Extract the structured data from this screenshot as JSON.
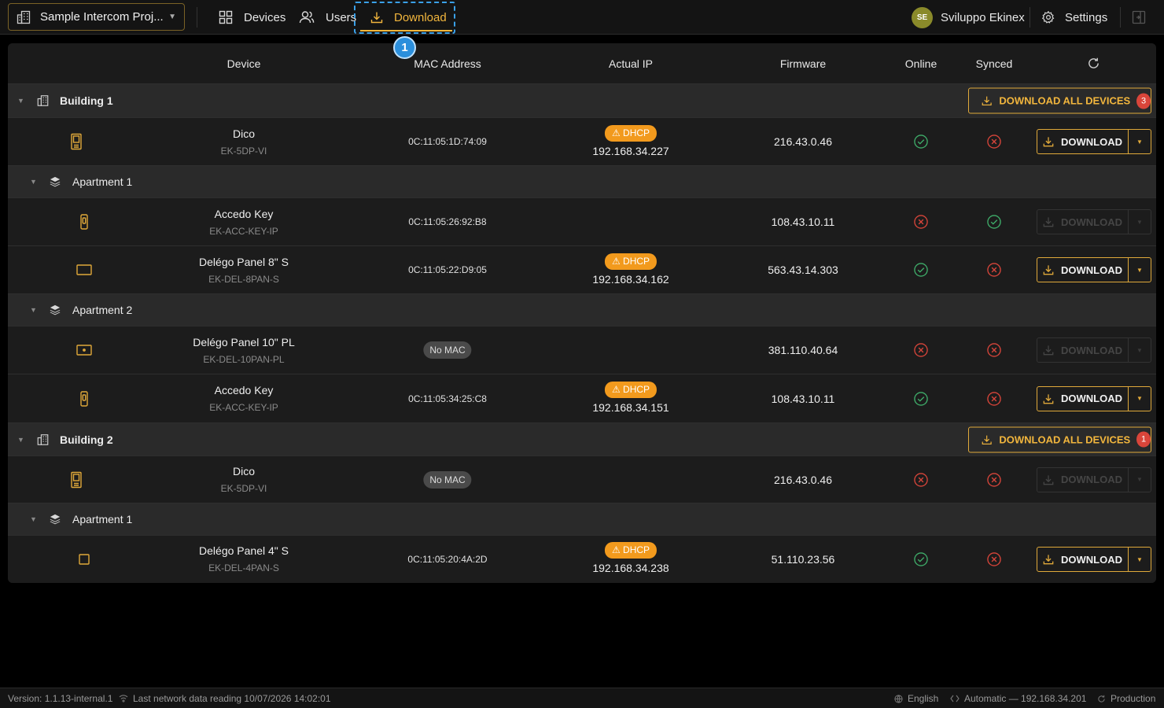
{
  "topbar": {
    "project_name": "Sample Intercom Proj...",
    "nav": {
      "devices": "Devices",
      "users": "Users",
      "download": "Download"
    },
    "step_badge": "1",
    "user": {
      "initials": "SE",
      "name": "Sviluppo Ekinex"
    },
    "settings": "Settings"
  },
  "table": {
    "headers": {
      "device": "Device",
      "mac": "MAC Address",
      "ip": "Actual IP",
      "firmware": "Firmware",
      "online": "Online",
      "synced": "Synced"
    },
    "download_label": "DOWNLOAD",
    "download_all_label": "DOWNLOAD ALL DEVICES",
    "dhcp_label": "⚠ DHCP",
    "no_mac_label": "No MAC",
    "building1": {
      "name": "Building 1",
      "pending": "3",
      "dico": {
        "name": "Dico",
        "model": "EK-5DP-VI",
        "mac": "0C:11:05:1D:74:09",
        "ip": "192.168.34.227",
        "firmware": "216.43.0.46",
        "online": true,
        "synced": false
      },
      "apt1": {
        "name": "Apartment 1",
        "key": {
          "name": "Accedo Key",
          "model": "EK-ACC-KEY-IP",
          "mac": "0C:11:05:26:92:B8",
          "firmware": "108.43.10.11",
          "online": false,
          "synced": true
        },
        "panel": {
          "name": "Delégo Panel 8\" S",
          "model": "EK-DEL-8PAN-S",
          "mac": "0C:11:05:22:D9:05",
          "ip": "192.168.34.162",
          "firmware": "563.43.14.303",
          "online": true,
          "synced": false
        }
      },
      "apt2": {
        "name": "Apartment 2",
        "panel": {
          "name": "Delégo Panel 10\" PL",
          "model": "EK-DEL-10PAN-PL",
          "firmware": "381.110.40.64",
          "online": false,
          "synced": false
        },
        "key": {
          "name": "Accedo Key",
          "model": "EK-ACC-KEY-IP",
          "mac": "0C:11:05:34:25:C8",
          "ip": "192.168.34.151",
          "firmware": "108.43.10.11",
          "online": true,
          "synced": false
        }
      }
    },
    "building2": {
      "name": "Building 2",
      "pending": "1",
      "dico": {
        "name": "Dico",
        "model": "EK-5DP-VI",
        "firmware": "216.43.0.46",
        "online": false,
        "synced": false
      },
      "apt1": {
        "name": "Apartment 1",
        "panel": {
          "name": "Delégo Panel 4\" S",
          "model": "EK-DEL-4PAN-S",
          "mac": "0C:11:05:20:4A:2D",
          "ip": "192.168.34.238",
          "firmware": "51.110.23.56",
          "online": true,
          "synced": false
        }
      }
    }
  },
  "statusbar": {
    "version": "Version: 1.1.13-internal.1",
    "last_reading": "Last network data reading 10/07/2026 14:02:01",
    "language": "English",
    "network": "Automatic — 192.168.34.201",
    "environment": "Production"
  },
  "colors": {
    "accent": "#f2b63d",
    "ok": "#3fae6a",
    "error": "#d9453a",
    "dhcp": "#f29a1d",
    "highlight": "#3aa0e8"
  }
}
